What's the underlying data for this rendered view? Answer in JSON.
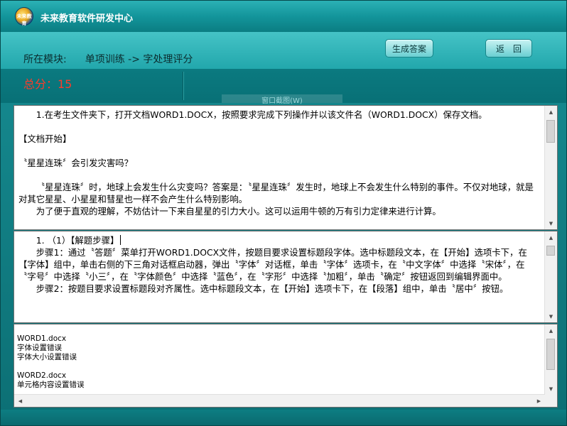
{
  "app": {
    "title": "未来教育软件研发中心",
    "logo_text": "未来教育"
  },
  "header": {
    "module_label": "所在模块:",
    "module_path": "单项训练 -> 字处理评分",
    "generate_button": "生成答案",
    "back_button": "返回"
  },
  "score": {
    "text": "总分：15"
  },
  "ghost_tab": {
    "text": "窗口截图(W)"
  },
  "question_pane": {
    "lines": [
      "1.在考生文件夹下，打开文档WORD1.DOCX，按照要求完成下列操作并以该文件名（WORD1.DOCX）保存文档。",
      "",
      "【文档开始】",
      "",
      "〝星星连珠〞会引发灾害吗？",
      "",
      "〝星星连珠〞时，地球上会发生什么灾变吗？答案是：〝星星连珠〞发生时，地球上不会发生什么特别的事件。不仅对地球，就是对其它星星、小星星和彗星也一样不会产生什么特别影响。",
      "为了便于直观的理解，不妨估计一下来自星星的引力大小。这可以运用牛顿的万有引力定律来进行计算。"
    ]
  },
  "steps_pane": {
    "heading": "1. （1）【解题步骤】",
    "step1": "步骤1：通过〝答题〞菜单打开WORD1.DOCX文件，按题目要求设置标题段字体。选中标题段文本，在【开始】选项卡下，在【字体】组中，单击右侧的下三角对话框启动器，弹出〝字体〞对话框，单击〝字体〞选项卡，在〝中文字体〞中选择〝宋体〞，在〝字号〞中选择〝小三〞，在〝字体颜色〞中选择〝蓝色〞，在〝字形〞中选择〝加粗〞，单击〝确定〞按钮返回到编辑界面中。",
    "step2": "步骤2：按题目要求设置标题段对齐属性。选中标题段文本，在【开始】选项卡下，在【段落】组中，单击〝居中〞按钮。"
  },
  "result_pane": {
    "lines": [
      "WORD1.docx",
      "字体设置错误",
      "字体大小设置错误",
      "",
      "WORD2.docx",
      "单元格内容设置错误"
    ]
  }
}
